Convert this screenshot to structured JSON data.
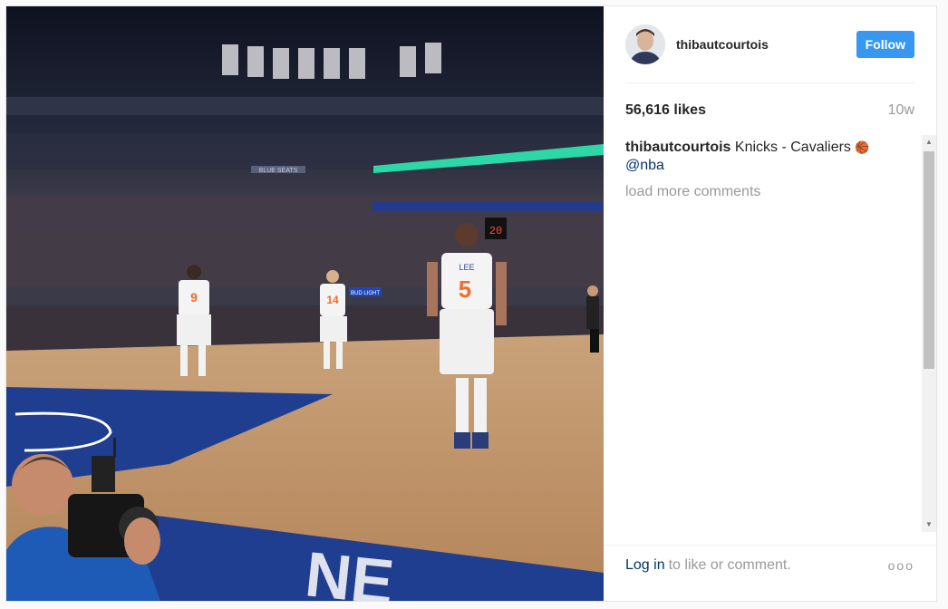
{
  "header": {
    "username": "thibautcourtois",
    "follow_label": "Follow",
    "avatar_icon": "profile-avatar"
  },
  "stats": {
    "likes": "56,616 likes",
    "time_ago": "10w"
  },
  "caption": {
    "user": "thibautcourtois",
    "text": "Knicks - Cavaliers",
    "emoji": "🏀",
    "mention": "@nba"
  },
  "comments": {
    "load_more": "load more comments"
  },
  "footer": {
    "login_label": "Log in",
    "rest": "to like or comment.",
    "more_icon": "more-options-dots",
    "more_text": "ooo"
  },
  "photo": {
    "scoreboard": "20",
    "player_number_near": "5",
    "player_name_near": "LEE",
    "player_number_far": "9",
    "player_number_mid": "14",
    "banner_text": "BLUE SEATS",
    "sign_text": "BUD LIGHT",
    "court_text": "NE"
  },
  "colors": {
    "follow_blue": "#3897f0",
    "link_blue": "#003569",
    "muted": "#999999",
    "court_blue": "#1f3e8f"
  }
}
